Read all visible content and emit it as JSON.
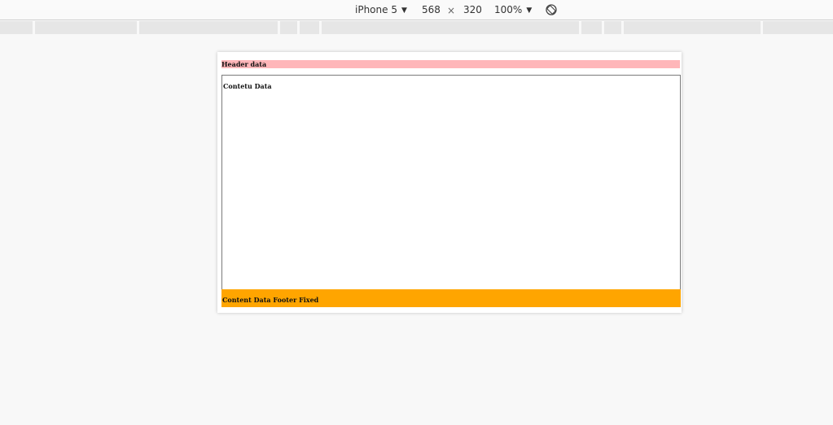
{
  "toolbar": {
    "device": "iPhone 5",
    "width": "568",
    "times": "×",
    "height": "320",
    "zoom": "100%",
    "dropdown_icon": "caret-down-icon",
    "rotate_icon": "rotate-icon"
  },
  "page": {
    "header_text": "Header data",
    "content_text": "Contetu Data",
    "footer_text": "Content Data Footer Fixed",
    "header_color": "#ffb6b9",
    "footer_color": "#ffa500"
  }
}
